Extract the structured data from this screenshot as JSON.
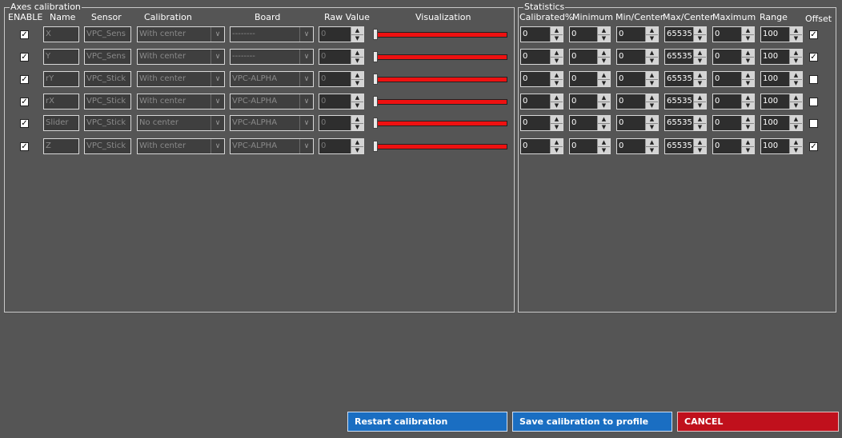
{
  "axes_group": {
    "title": "Axes calibration"
  },
  "stats_group": {
    "title": "Statistics"
  },
  "axes_headers": {
    "enable": "ENABLE",
    "name": "Name",
    "sensor": "Sensor",
    "calibration": "Calibration",
    "board": "Board",
    "raw_value": "Raw Value",
    "visualization": "Visualization"
  },
  "stats_headers": {
    "calibrated": "Calibrated%",
    "minimum": "Minimum",
    "min_center": "Min/Center",
    "max_center": "Max/Center",
    "maximum": "Maximum",
    "range": "Range",
    "offset": "Offset"
  },
  "rows": [
    {
      "enabled": true,
      "name": "X",
      "sensor": "VPC_Sens",
      "calibration": "With center",
      "board": "--------",
      "raw": "0",
      "level": 0,
      "calibrated": "0",
      "minimum": "0",
      "min_center": "0",
      "max_center": "65535",
      "maximum": "0",
      "range": "100",
      "offset": true
    },
    {
      "enabled": true,
      "name": "Y",
      "sensor": "VPC_Sens",
      "calibration": "With center",
      "board": "--------",
      "raw": "0",
      "level": 0,
      "calibrated": "0",
      "minimum": "0",
      "min_center": "0",
      "max_center": "65535",
      "maximum": "0",
      "range": "100",
      "offset": true
    },
    {
      "enabled": true,
      "name": "rY",
      "sensor": "VPC_Stick",
      "calibration": "With center",
      "board": "VPC-ALPHA",
      "raw": "0",
      "level": 0,
      "calibrated": "0",
      "minimum": "0",
      "min_center": "0",
      "max_center": "65535",
      "maximum": "0",
      "range": "100",
      "offset": false
    },
    {
      "enabled": true,
      "name": "rX",
      "sensor": "VPC_Stick",
      "calibration": "With center",
      "board": "VPC-ALPHA",
      "raw": "0",
      "level": 0,
      "calibrated": "0",
      "minimum": "0",
      "min_center": "0",
      "max_center": "65535",
      "maximum": "0",
      "range": "100",
      "offset": false
    },
    {
      "enabled": true,
      "name": "Slider",
      "sensor": "VPC_Stick",
      "calibration": "No center",
      "board": "VPC-ALPHA",
      "raw": "0",
      "level": 0,
      "calibrated": "0",
      "minimum": "0",
      "min_center": "0",
      "max_center": "65535",
      "maximum": "0",
      "range": "100",
      "offset": false
    },
    {
      "enabled": true,
      "name": "Z",
      "sensor": "VPC_Stick",
      "calibration": "With center",
      "board": "VPC-ALPHA",
      "raw": "0",
      "level": 0,
      "calibrated": "0",
      "minimum": "0",
      "min_center": "0",
      "max_center": "65535",
      "maximum": "0",
      "range": "100",
      "offset": true
    }
  ],
  "buttons": {
    "restart": "Restart calibration",
    "save": "Save calibration  to profile",
    "cancel": "CANCEL"
  },
  "colors": {
    "primary_button": "#1a6ec2",
    "cancel_button": "#c0101c",
    "slider_track": "#e11111"
  }
}
